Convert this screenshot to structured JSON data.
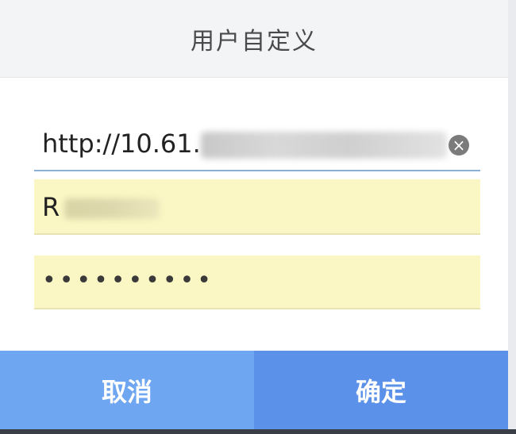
{
  "dialog": {
    "title": "用户自定义",
    "url_field": {
      "visible_value": "http://10.61."
    },
    "username_field": {
      "visible_value": "R"
    },
    "password_field": {
      "masked_value": "••••••••••"
    },
    "buttons": {
      "cancel_label": "取消",
      "confirm_label": "确定"
    }
  },
  "colors": {
    "header_bg": "#f3f4f6",
    "autofill_bg": "#fbf7c4",
    "cancel_bg": "#6fa6f1",
    "confirm_bg": "#5b91e8"
  }
}
